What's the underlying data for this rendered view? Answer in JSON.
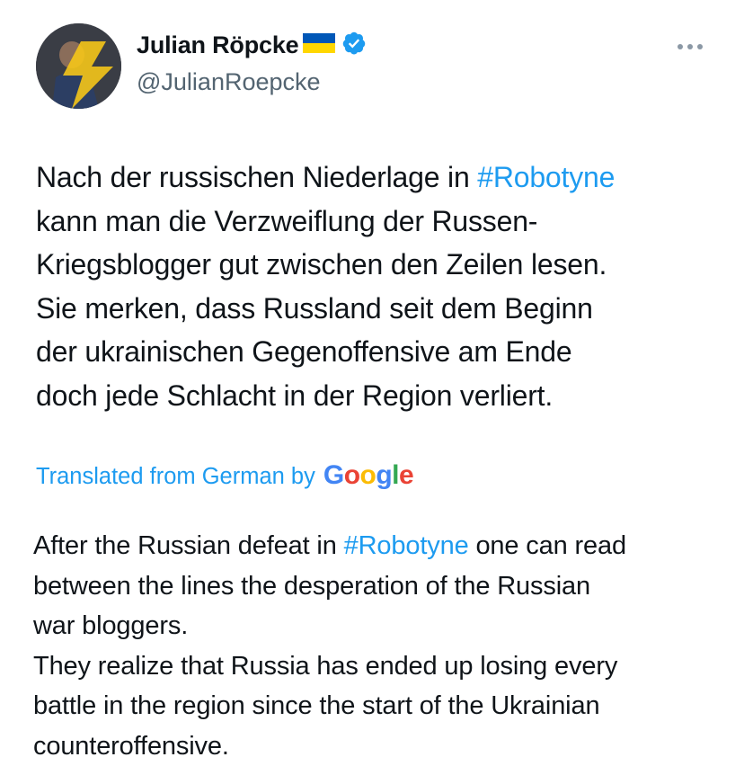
{
  "author": {
    "display_name": "Julian Röpcke",
    "handle": "@JulianRoepcke",
    "flag_icon": "ukraine-flag-icon",
    "verified_icon": "verified-badge-icon"
  },
  "colors": {
    "text": "#0f1419",
    "secondary": "#536471",
    "link": "#1d9bf0",
    "verified": "#1d9bf0",
    "flag_blue": "#0057b7",
    "flag_yellow": "#ffd700"
  },
  "more_menu": {
    "icon": "more-options-icon"
  },
  "tweet": {
    "lines": [
      {
        "pre": "Nach der russischen Niederlage in ",
        "hashtag": "#Robotyne"
      },
      {
        "text": "kann man die Verzweiflung der Russen-"
      },
      {
        "text": "Kriegsblogger gut zwischen den Zeilen lesen."
      },
      {
        "text": "Sie merken, dass Russland seit dem Beginn"
      },
      {
        "text": "der ukrainischen Gegenoffensive am Ende"
      },
      {
        "text": "doch jede Schlacht in der Region verliert."
      }
    ]
  },
  "translation": {
    "label": "Translated from German by",
    "provider": "Google",
    "lines": [
      {
        "pre": "After the Russian defeat in ",
        "hashtag": "#Robotyne",
        "post": " one can read"
      },
      {
        "text": "between the lines the desperation of the Russian"
      },
      {
        "text": "war bloggers."
      },
      {
        "text": "They realize that Russia has ended up losing every"
      },
      {
        "text": "battle in the region since the start of the Ukrainian"
      },
      {
        "text": "counteroffensive."
      }
    ]
  }
}
